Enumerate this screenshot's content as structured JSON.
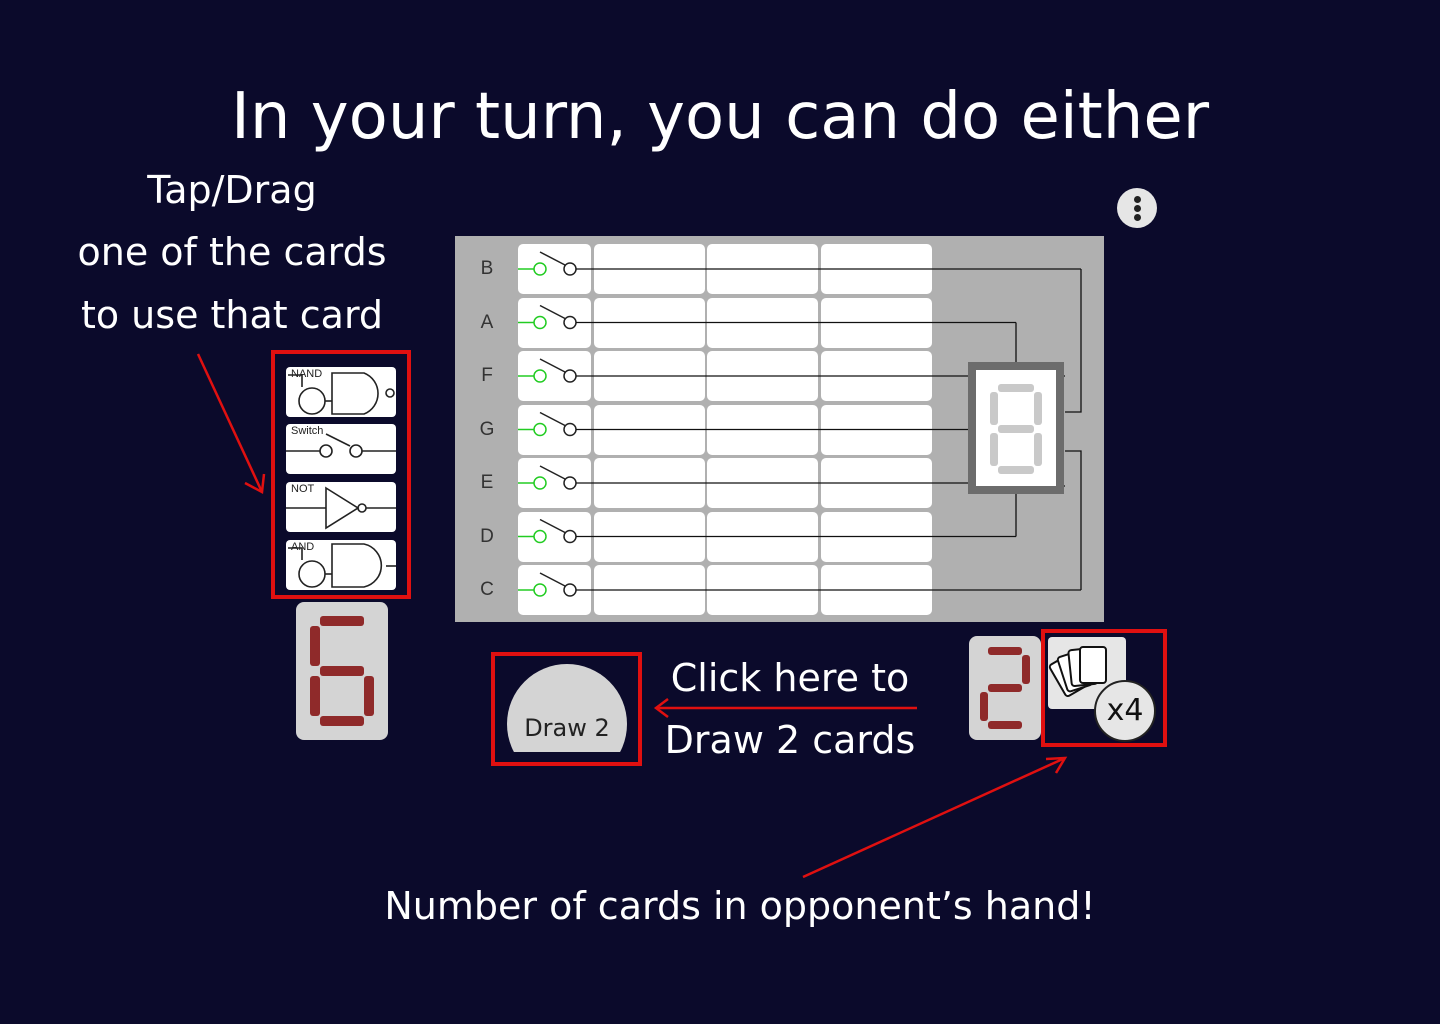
{
  "title": "In your turn, you can do either",
  "instructions": {
    "left_line1": "Tap/Drag",
    "left_line2": "one of the cards",
    "left_line3": "to use that card",
    "draw_line1": "Click here to",
    "draw_line2": "Draw 2 cards",
    "opponent_note": "Number of cards in opponent’s hand!"
  },
  "board": {
    "rows": [
      "B",
      "A",
      "F",
      "G",
      "E",
      "D",
      "C"
    ]
  },
  "hand": {
    "cards": [
      {
        "label": "NAND",
        "icon": "nand-gate-icon"
      },
      {
        "label": "Switch",
        "icon": "switch-icon"
      },
      {
        "label": "NOT",
        "icon": "not-gate-icon"
      },
      {
        "label": "AND",
        "icon": "and-gate-icon"
      }
    ],
    "count_digit": 6
  },
  "draw_button": {
    "label": "Draw 2"
  },
  "opponent": {
    "score_digit": 2,
    "deck_count_label": "x4"
  },
  "colors": {
    "background": "#0b0a2b",
    "highlight": "#e01010",
    "segment_on": "#8f2a2a",
    "switch_green": "#22cc22"
  }
}
